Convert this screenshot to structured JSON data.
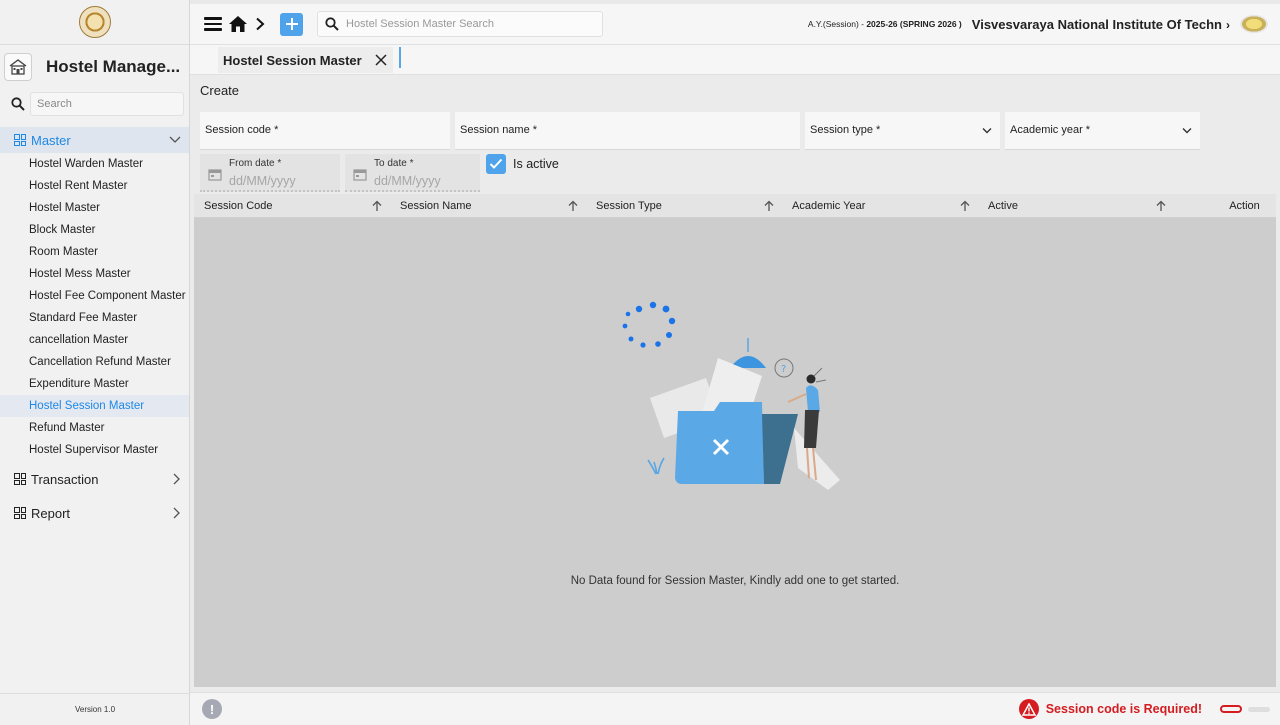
{
  "sidebar": {
    "app_title": "Hostel Manage...",
    "search_placeholder": "Search",
    "master": {
      "label": "Master",
      "items": [
        "Hostel Warden Master",
        "Hostel Rent Master",
        "Hostel Master",
        "Block Master",
        "Room Master",
        "Hostel Mess Master",
        "Hostel Fee Component Master",
        "Standard Fee Master",
        "cancellation Master",
        "Cancellation Refund Master",
        "Expenditure Master",
        "Hostel Session Master",
        "Refund Master",
        "Hostel Supervisor Master"
      ],
      "selected": "Hostel Session Master"
    },
    "transaction_label": "Transaction",
    "report_label": "Report",
    "version": "Version 1.0"
  },
  "topbar": {
    "search_placeholder": "Hostel Session Master Search",
    "session_prefix": "A.Y.(Session) - ",
    "session_value": "2025-26 (SPRING 2026 )",
    "institute": "Visvesvaraya National Institute Of Techn",
    "institute_chevron": "›"
  },
  "tabs": [
    {
      "label": "Hostel Session Master"
    }
  ],
  "form": {
    "title": "Create",
    "session_code_label": "Session code *",
    "session_name_label": "Session name *",
    "session_type_label": "Session type *",
    "academic_year_label": "Academic year *",
    "from_date_label": "From date *",
    "from_date_placeholder": "dd/MM/yyyy",
    "to_date_label": "To date *",
    "to_date_placeholder": "dd/MM/yyyy",
    "is_active_label": "Is active",
    "is_active_checked": true
  },
  "table": {
    "columns": [
      "Session Code",
      "Session Name",
      "Session Type",
      "Academic Year",
      "Active",
      "Action"
    ],
    "rows": [],
    "empty_message": "No Data found for Session Master, Kindly add one to get started."
  },
  "statusbar": {
    "info_glyph": "!",
    "error_message": "Session code is Required!"
  },
  "colors": {
    "accent": "#1e88e5",
    "button_blue": "#4ea3ea",
    "error": "#d51c20",
    "table_bg": "#cdcdcd"
  }
}
